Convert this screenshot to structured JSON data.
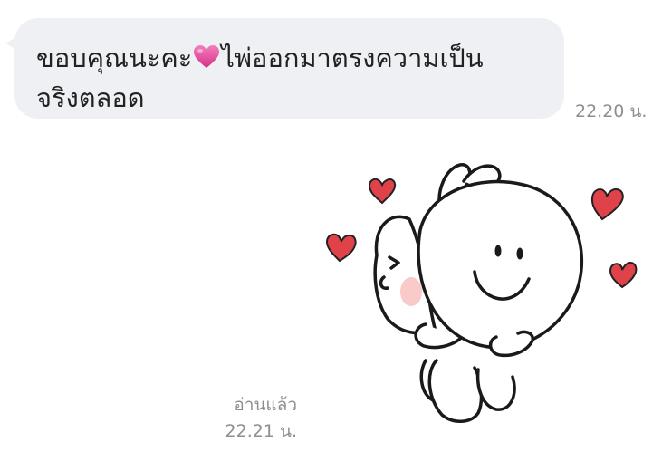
{
  "conversation": {
    "incoming_message": {
      "text_before_emoji": "ขอบคุณนะคะ",
      "emoji": "pink-heart",
      "text_after_emoji": "ไพ่ออกมาตรงความเป็น\nจริงตลอด",
      "time": "22.20 น."
    },
    "outgoing_sticker": {
      "sticker": "bunny-hugging-smiling-ball-with-hearts",
      "read_status": "อ่านแล้ว",
      "time": "22.21 น."
    }
  },
  "colors": {
    "bubble_background": "#eff0f3",
    "message_text": "#222222",
    "timestamp_text": "#8e8e93",
    "heart_red": "#e0424a",
    "emoji_pink": "#e8489a"
  }
}
